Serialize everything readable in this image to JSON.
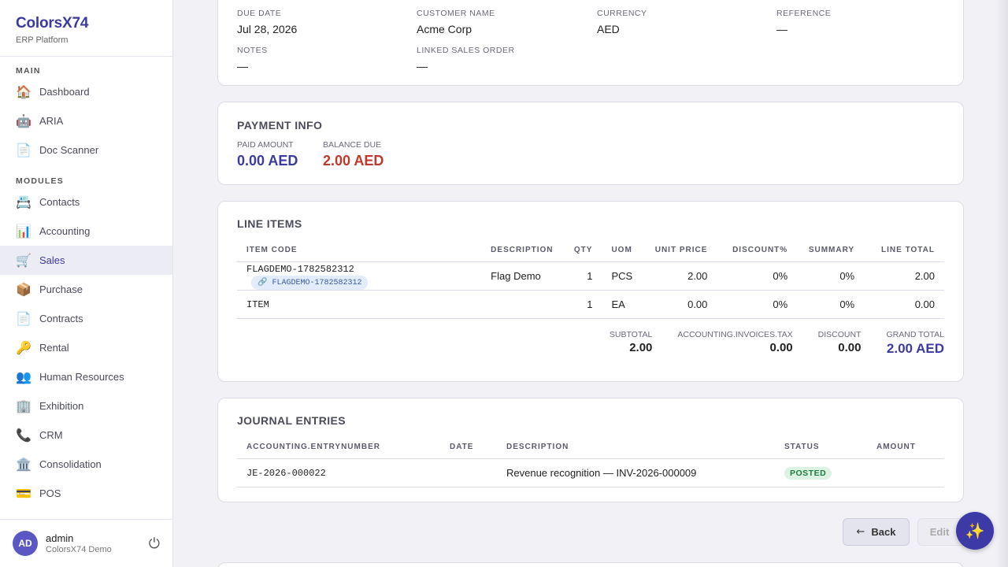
{
  "brand": {
    "title": "ColorsX74",
    "subtitle": "ERP Platform"
  },
  "nav": {
    "main_label": "MAIN",
    "main_items": [
      {
        "label": "Dashboard",
        "icon": "🏠"
      },
      {
        "label": "ARIA",
        "icon": "🤖"
      },
      {
        "label": "Doc Scanner",
        "icon": "📄"
      }
    ],
    "modules_label": "MODULES",
    "module_items": [
      {
        "label": "Contacts",
        "icon": "📇"
      },
      {
        "label": "Accounting",
        "icon": "📊"
      },
      {
        "label": "Sales",
        "icon": "🛒",
        "active": true
      },
      {
        "label": "Purchase",
        "icon": "📦"
      },
      {
        "label": "Contracts",
        "icon": "📄"
      },
      {
        "label": "Rental",
        "icon": "🔑"
      },
      {
        "label": "Human Resources",
        "icon": "👥"
      },
      {
        "label": "Exhibition",
        "icon": "🏢"
      },
      {
        "label": "CRM",
        "icon": "📞"
      },
      {
        "label": "Consolidation",
        "icon": "🏛️"
      },
      {
        "label": "POS",
        "icon": "💳"
      }
    ]
  },
  "user": {
    "initials": "AD",
    "name": "admin",
    "org": "ColorsX74 Demo",
    "power_icon": "⏻"
  },
  "details": {
    "due_date_label": "DUE DATE",
    "due_date": "Jul 28, 2026",
    "customer_label": "CUSTOMER NAME",
    "customer": "Acme Corp",
    "currency_label": "CURRENCY",
    "currency": "AED",
    "reference_label": "REFERENCE",
    "reference": "—",
    "notes_label": "NOTES",
    "notes": "—",
    "linked_so_label": "LINKED SALES ORDER",
    "linked_so": "—"
  },
  "payment": {
    "title": "PAYMENT INFO",
    "paid_label": "PAID AMOUNT",
    "paid": "0.00 AED",
    "balance_label": "BALANCE DUE",
    "balance": "2.00 AED"
  },
  "line_items": {
    "title": "LINE ITEMS",
    "columns": [
      "ITEM CODE",
      "DESCRIPTION",
      "QTY",
      "UOM",
      "UNIT PRICE",
      "DISCOUNT%",
      "SUMMARY",
      "LINE TOTAL"
    ],
    "rows": [
      {
        "code": "FLAGDEMO-1782582312",
        "tag": "FLAGDEMO-1782582312",
        "description": "Flag Demo",
        "qty": "1",
        "uom": "PCS",
        "unit_price": "2.00",
        "discount": "0%",
        "summary": "0%",
        "total": "2.00"
      },
      {
        "code": "ITEM",
        "tag": "",
        "description": "",
        "qty": "1",
        "uom": "EA",
        "unit_price": "0.00",
        "discount": "0%",
        "summary": "0%",
        "total": "0.00"
      }
    ],
    "totals": {
      "subtotal_label": "SUBTOTAL",
      "subtotal": "2.00",
      "tax_label": "ACCOUNTING.INVOICES.TAX",
      "tax": "0.00",
      "discount_label": "DISCOUNT",
      "discount": "0.00",
      "grand_label": "GRAND TOTAL",
      "grand": "2.00 AED"
    }
  },
  "journal": {
    "title": "JOURNAL ENTRIES",
    "columns": [
      "ACCOUNTING.ENTRYNUMBER",
      "DATE",
      "DESCRIPTION",
      "STATUS",
      "AMOUNT"
    ],
    "rows": [
      {
        "entry": "JE-2026-000022",
        "date": "",
        "description": "Revenue recognition — INV-2026-000009",
        "status": "POSTED",
        "amount": ""
      }
    ]
  },
  "actions": {
    "back_arrow": "←",
    "back": "Back",
    "edit": "Edit",
    "ai_icon": "✨"
  },
  "colors": {
    "accent": "#3d3a9e",
    "balance_due": "#c0392b",
    "posted": "#1e7a3e"
  }
}
